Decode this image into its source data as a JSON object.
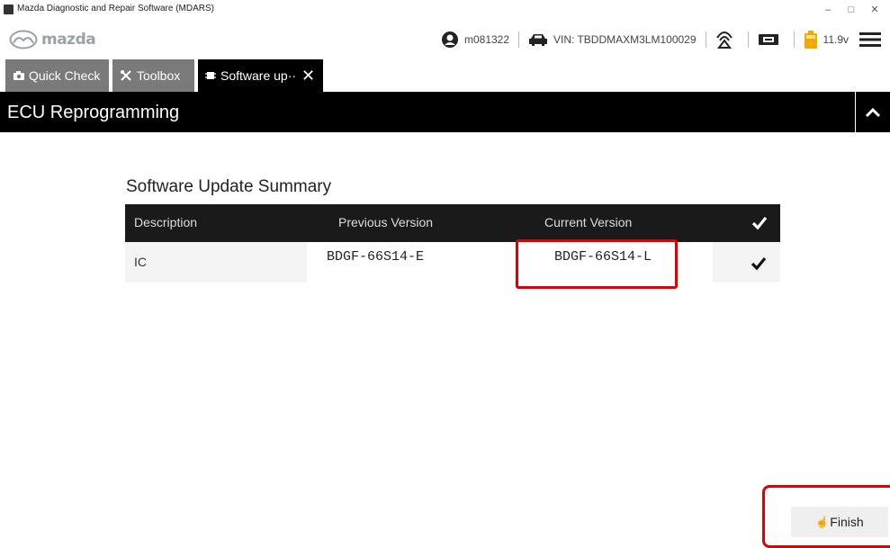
{
  "window": {
    "title": "Mazda Diagnostic and Repair Software (MDARS)",
    "controls": {
      "minimize": "–",
      "maximize": "□",
      "close": "✕"
    }
  },
  "header": {
    "logo_text": "mazda",
    "user": "m081322",
    "vin": "VIN: TBDDMAXM3LM100029",
    "voltage": "11.9v"
  },
  "tabs": [
    {
      "label": "Quick Check",
      "icon": "camera-icon"
    },
    {
      "label": "Toolbox",
      "icon": "tools-icon"
    },
    {
      "label": "Software up··",
      "icon": "chip-icon",
      "active": true
    }
  ],
  "banner": {
    "title": "ECU Reprogramming"
  },
  "summary": {
    "title": "Software Update Summary",
    "columns": [
      "Description",
      "Previous Version",
      "Current Version"
    ],
    "rows": [
      {
        "description": "IC",
        "previous": "BDGF-66S14-E",
        "current": "BDGF-66S14-L",
        "status": "success"
      }
    ]
  },
  "footer": {
    "finish_label": "Finish"
  },
  "colors": {
    "highlight": "#e00000",
    "banner": "#000000",
    "tab_inactive": "#7a7a7a"
  }
}
